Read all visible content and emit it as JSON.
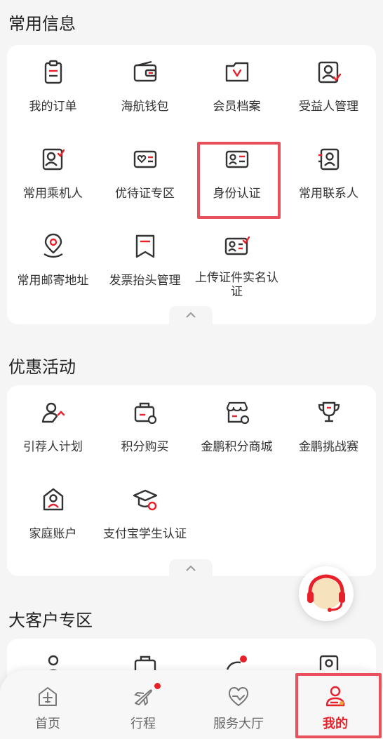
{
  "sections": {
    "common": {
      "title": "常用信息",
      "items": [
        {
          "label": "我的订单",
          "icon": "order-clipboard-icon"
        },
        {
          "label": "海航钱包",
          "icon": "wallet-icon"
        },
        {
          "label": "会员档案",
          "icon": "member-file-icon"
        },
        {
          "label": "受益人管理",
          "icon": "beneficiary-icon"
        },
        {
          "label": "常用乘机人",
          "icon": "passenger-card-icon"
        },
        {
          "label": "优待证专区",
          "icon": "preferential-card-icon"
        },
        {
          "label": "身份认证",
          "icon": "identity-card-icon"
        },
        {
          "label": "常用联系人",
          "icon": "contact-book-icon"
        },
        {
          "label": "常用邮寄地址",
          "icon": "location-pin-icon"
        },
        {
          "label": "发票抬头管理",
          "icon": "invoice-icon"
        },
        {
          "label": "上传证件实名认证",
          "icon": "upload-id-icon"
        }
      ]
    },
    "promo": {
      "title": "优惠活动",
      "items": [
        {
          "label": "引荐人计划",
          "icon": "referral-icon"
        },
        {
          "label": "积分购买",
          "icon": "points-purchase-icon"
        },
        {
          "label": "金鹏积分商城",
          "icon": "points-mall-icon"
        },
        {
          "label": "金鹏挑战赛",
          "icon": "trophy-icon"
        },
        {
          "label": "家庭账户",
          "icon": "family-account-icon"
        },
        {
          "label": "支付宝学生认证",
          "icon": "graduation-cap-icon"
        }
      ]
    },
    "corporate": {
      "title": "大客户专区"
    }
  },
  "tabbar": {
    "items": [
      {
        "label": "首页",
        "icon": "home-plane-icon"
      },
      {
        "label": "行程",
        "icon": "trip-plane-icon"
      },
      {
        "label": "服务大厅",
        "icon": "service-hall-icon"
      },
      {
        "label": "我的",
        "icon": "profile-icon"
      }
    ],
    "active": "我的"
  },
  "colors": {
    "accent": "#e8202a",
    "highlight": "#e8505b",
    "icon_stroke": "#333333",
    "background": "#f5f5f5"
  }
}
